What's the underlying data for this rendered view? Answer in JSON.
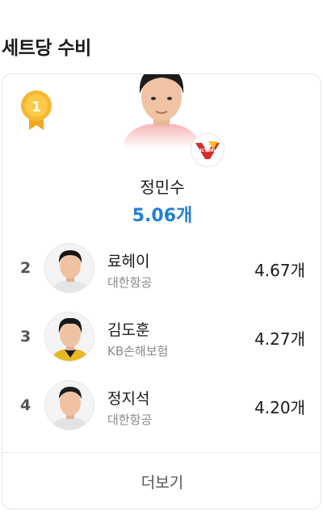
{
  "section": {
    "title": "세트당 수비"
  },
  "leader": {
    "rank": "1",
    "name": "정민수",
    "value": "5.06개",
    "team_logo_text": "VICTORIA"
  },
  "others": [
    {
      "rank": "2",
      "name": "료헤이",
      "team": "대한항공",
      "value": "4.67개"
    },
    {
      "rank": "3",
      "name": "김도훈",
      "team": "KB손해보험",
      "value": "4.27개"
    },
    {
      "rank": "4",
      "name": "정지석",
      "team": "대한항공",
      "value": "4.20개"
    }
  ],
  "more_label": "더보기",
  "colors": {
    "accent": "#1f7fd8",
    "medal": "#f5a623"
  }
}
